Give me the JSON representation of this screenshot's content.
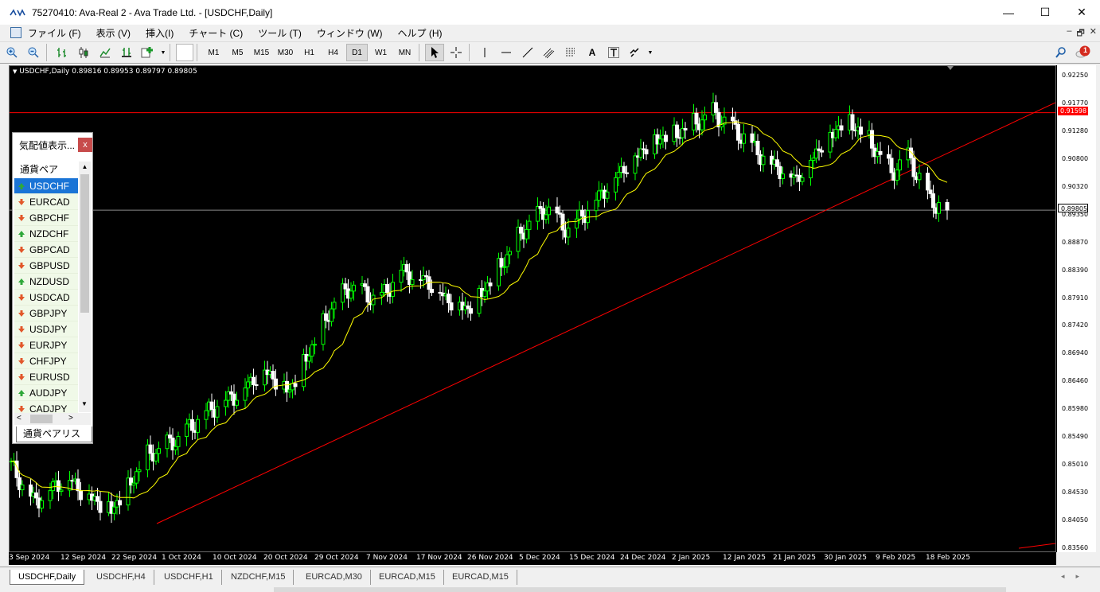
{
  "window": {
    "title": "75270410: Ava-Real 2 - Ava Trade Ltd. - [USDCHF,Daily]",
    "controls": [
      "—",
      "☐",
      "✕"
    ]
  },
  "menu": [
    "ファイル (F)",
    "表示 (V)",
    "挿入(I)",
    "チャート (C)",
    "ツール (T)",
    "ウィンドウ (W)",
    "ヘルプ (H)"
  ],
  "mdi_controls": [
    "‒",
    "🗗",
    "✕"
  ],
  "toolbar": {
    "timeframes": [
      "M1",
      "M5",
      "M15",
      "M30",
      "H1",
      "H4",
      "D1",
      "W1",
      "MN"
    ],
    "active_timeframe": "D1",
    "notification_count": "1"
  },
  "chart": {
    "header": "USDCHF,Daily  0.89816 0.89953 0.89797 0.89805",
    "y_ticks": [
      "0.92250",
      "0.91770",
      "0.91280",
      "0.90800",
      "0.90320",
      "0.89350",
      "0.88870",
      "0.88390",
      "0.87910",
      "0.87420",
      "0.86940",
      "0.86460",
      "0.85980",
      "0.85490",
      "0.85010",
      "0.84530",
      "0.84050",
      "0.83560"
    ],
    "hline_red_label": "0.91598",
    "current_price_label": "0.89805",
    "x_ticks": [
      "3 Sep 2024",
      "12 Sep 2024",
      "22 Sep 2024",
      "1 Oct 2024",
      "10 Oct 2024",
      "20 Oct 2024",
      "29 Oct 2024",
      "7 Nov 2024",
      "17 Nov 2024",
      "26 Nov 2024",
      "5 Dec 2024",
      "15 Dec 2024",
      "24 Dec 2024",
      "2 Jan 2025",
      "12 Jan 2025",
      "21 Jan 2025",
      "30 Jan 2025",
      "9 Feb 2025",
      "18 Feb 2025"
    ],
    "colors": {
      "up": "#00ff00",
      "down": "#ffffff",
      "ma": "#ffff00",
      "trend": "#ff0000",
      "bg": "#000000"
    }
  },
  "market_watch": {
    "title": "気配値表示...",
    "close": "x",
    "column": "通貨ペア",
    "items": [
      {
        "symbol": "USDCHF",
        "dir": "up"
      },
      {
        "symbol": "EURCAD",
        "dir": "down"
      },
      {
        "symbol": "GBPCHF",
        "dir": "down"
      },
      {
        "symbol": "NZDCHF",
        "dir": "up"
      },
      {
        "symbol": "GBPCAD",
        "dir": "down"
      },
      {
        "symbol": "GBPUSD",
        "dir": "down"
      },
      {
        "symbol": "NZDUSD",
        "dir": "up"
      },
      {
        "symbol": "USDCAD",
        "dir": "down"
      },
      {
        "symbol": "GBPJPY",
        "dir": "down"
      },
      {
        "symbol": "USDJPY",
        "dir": "down"
      },
      {
        "symbol": "EURJPY",
        "dir": "down"
      },
      {
        "symbol": "CHFJPY",
        "dir": "down"
      },
      {
        "symbol": "EURUSD",
        "dir": "down"
      },
      {
        "symbol": "AUDJPY",
        "dir": "up"
      },
      {
        "symbol": "CADJPY",
        "dir": "down"
      }
    ],
    "tab": "通貨ペアリスト"
  },
  "tabs": [
    "USDCHF,Daily",
    "USDCHF,H4",
    "USDCHF,H1",
    "NZDCHF,M15",
    "EURCAD,M30",
    "EURCAD,M15",
    "EURCAD,M15"
  ],
  "active_tab": "USDCHF,Daily"
}
